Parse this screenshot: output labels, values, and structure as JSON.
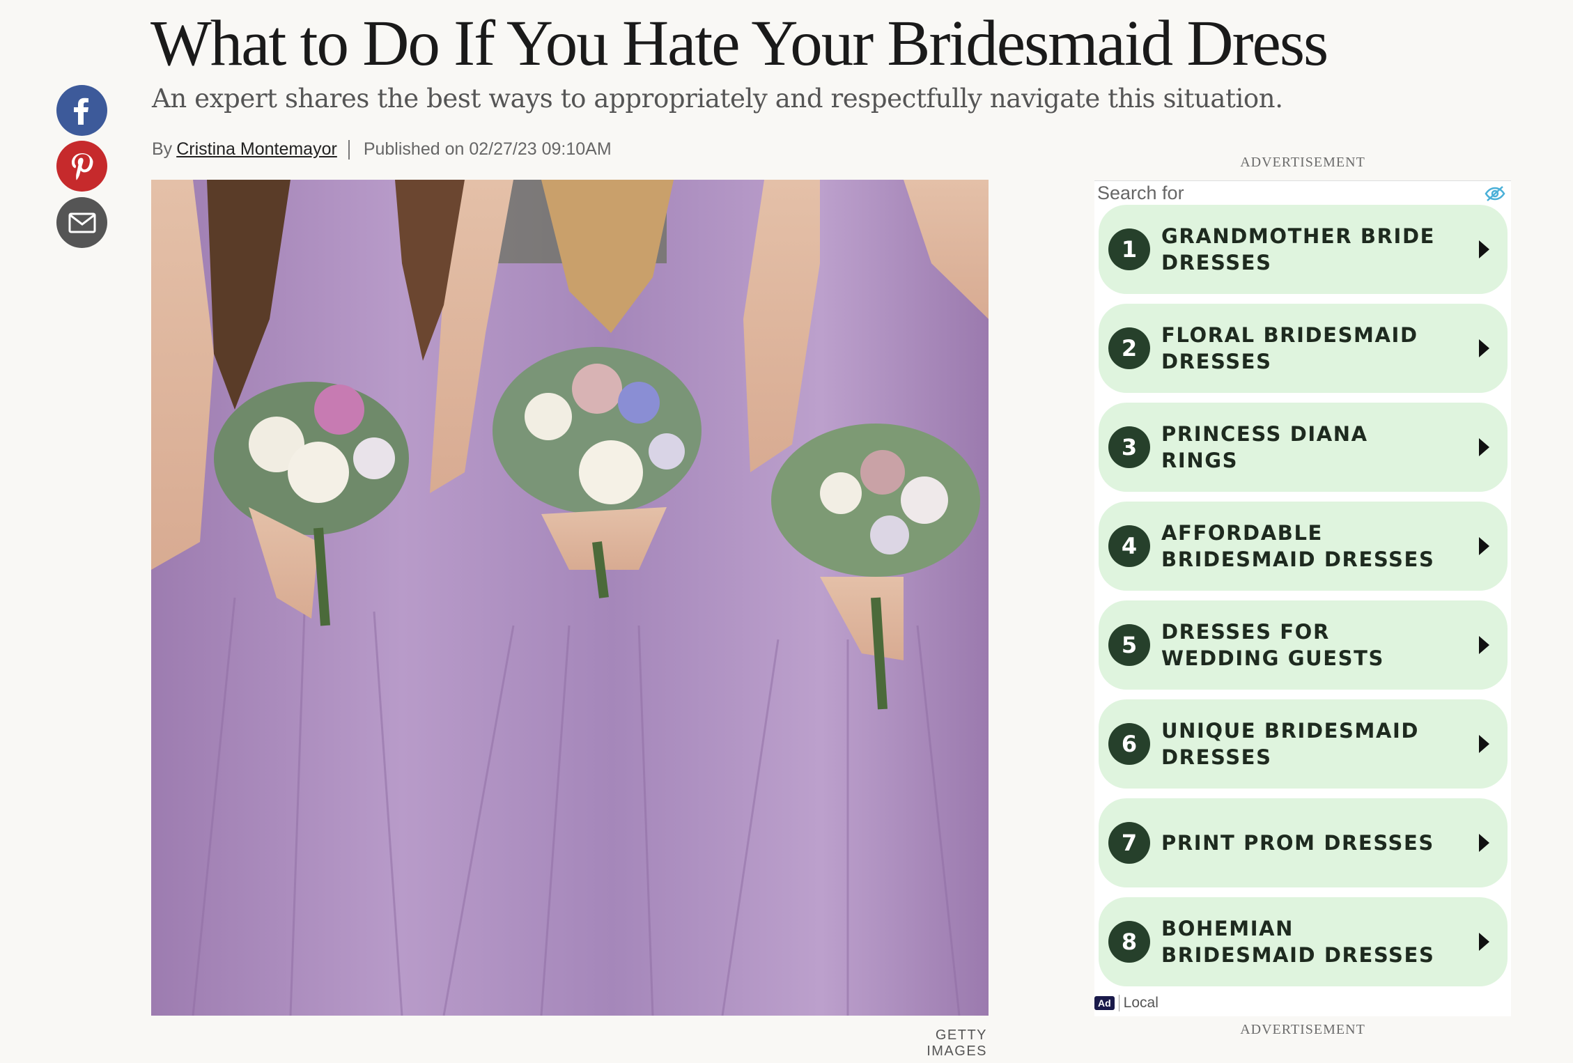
{
  "article": {
    "title": "What to Do If You Hate Your Bridesmaid Dress",
    "subtitle": "An expert shares the best ways to appropriately and respectfully navigate this situation.",
    "by": "By",
    "author": "Cristina Montemayor",
    "published": "Published on 02/27/23 09:10AM",
    "image_credit": "GETTY IMAGES"
  },
  "share": {
    "facebook_icon": "facebook-icon",
    "pinterest_icon": "pinterest-icon",
    "email_icon": "email-icon",
    "colors": {
      "facebook": "#3b5998",
      "pinterest": "#c8232c",
      "email": "#555555"
    }
  },
  "ad": {
    "label_top": "ADVERTISEMENT",
    "label_bottom": "ADVERTISEMENT",
    "search_for": "Search for",
    "footer_badge": "Ad",
    "footer_text": "Local",
    "item_bg": "#dff4de",
    "badge_color": "#26402b",
    "items": [
      {
        "num": "1",
        "label": "GRANDMOTHER BRIDE DRESSES"
      },
      {
        "num": "2",
        "label": "FLORAL BRIDESMAID DRESSES"
      },
      {
        "num": "3",
        "label": "PRINCESS DIANA RINGS"
      },
      {
        "num": "4",
        "label": "AFFORDABLE BRIDESMAID DRESSES"
      },
      {
        "num": "5",
        "label": "DRESSES FOR WEDDING GUESTS"
      },
      {
        "num": "6",
        "label": "UNIQUE BRIDESMAID DRESSES"
      },
      {
        "num": "7",
        "label": "PRINT PROM DRESSES"
      },
      {
        "num": "8",
        "label": "BOHEMIAN BRIDESMAID DRESSES"
      }
    ]
  }
}
